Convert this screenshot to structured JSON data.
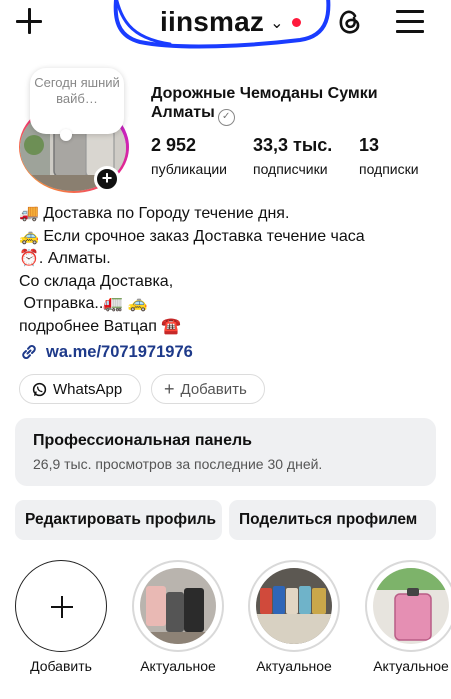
{
  "header": {
    "username": "iinsmaz",
    "chevron": "⌄",
    "icons": {
      "new_post": "plus-icon",
      "threads": "threads-icon",
      "menu": "hamburger-menu-icon"
    }
  },
  "profile": {
    "note_text": "Сегодн яшний вайб…",
    "display_name": "Дорожные Чемоданы  Сумки Алматы",
    "stats": [
      {
        "value": "2 952",
        "label": "публикации"
      },
      {
        "value": "33,3 тыс.",
        "label": "подписчики"
      },
      {
        "value": "13",
        "label": "подписки"
      }
    ],
    "bio_lines": [
      "🚚 Доставка по Городу течение дня.",
      "🚕 Если срочное заказ Доставка течение часа",
      "⏰.  Алматы.",
      "Со склада Доставка,",
      " Отправка..🚛 🚕",
      "подробнее Ватцап ☎️"
    ],
    "link": "wa.me/7071971976"
  },
  "chips": {
    "whatsapp": "WhatsApp",
    "add": "Добавить"
  },
  "pro_panel": {
    "title": "Профессиональная панель",
    "subtitle": "26,9 тыс. просмотров за последние 30 дней."
  },
  "actions": {
    "edit": "Редактировать профиль",
    "share": "Поделиться профилем"
  },
  "highlights": [
    {
      "label": "Добавить"
    },
    {
      "label": "Актуальное"
    },
    {
      "label": "Актуальное"
    },
    {
      "label": "Актуальное"
    }
  ],
  "colors": {
    "accent_link": "#1e3a8a",
    "notification_dot": "#ff1a3c",
    "scribble": "#1a3cff",
    "panel_bg": "#eff0f2"
  }
}
